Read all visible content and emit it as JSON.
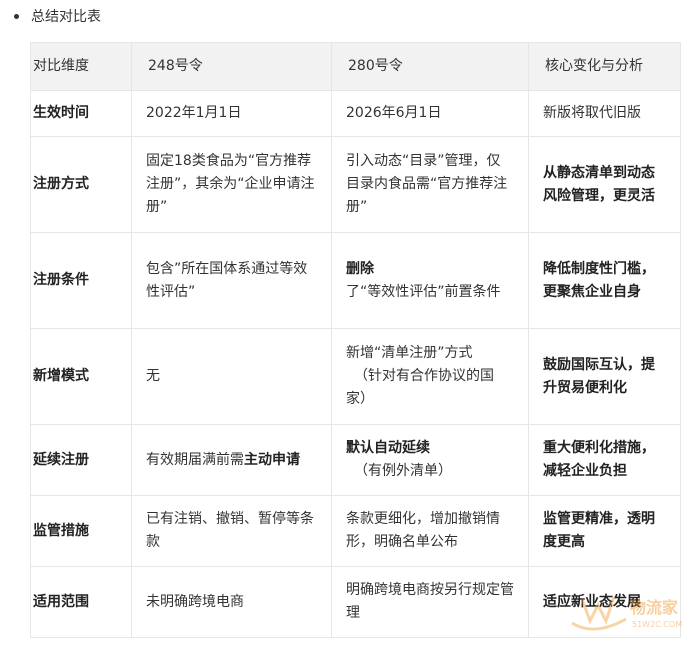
{
  "heading": "总结对比表",
  "table": {
    "headers": [
      "对比维度",
      "248号令",
      "280号令",
      "核心变化与分析"
    ],
    "rows": [
      {
        "dim": "生效时间",
        "c248": "2022年1月1日",
        "c280_a": "2026年6月1日",
        "c280_b": "",
        "analysis": "新版将取代旧版"
      },
      {
        "dim": "注册方式",
        "c248_a": "固定18类食品为“官方推荐注册”，其余为“企业申请注册”",
        "c280_a": "引入动态“目录”管理，仅目录内食品需“官方推荐注册”",
        "analysis": "从静态清单到动态风险管理，更灵活"
      },
      {
        "dim": "注册条件",
        "c248_a": "包含”所在国体系通过等效性评估”",
        "c280_bold": "删除",
        "c280_a": "了“等效性评估”前置条件",
        "analysis": "降低制度性门槛，更聚焦企业自身"
      },
      {
        "dim": "新增模式",
        "c248_a": "无",
        "c280_a": "新增“清单注册”方式",
        "c280_b": "（针对有合作协议的国家）",
        "analysis": "鼓励国际互认，提升贸易便利化"
      },
      {
        "dim": "延续注册",
        "c248_a": "有效期届满前需",
        "c248_bold": "主动申请",
        "c280_bold": "默认自动延续",
        "c280_b": "（有例外清单）",
        "analysis": "重大便利化措施，减轻企业负担"
      },
      {
        "dim": "监管措施",
        "c248_a": "已有注销、撤销、暂停等条款",
        "c280_a": "条款更细化，增加撤销情形，明确名单公布",
        "analysis": "监管更精准，透明度更高"
      },
      {
        "dim": "适用范围",
        "c248_a": "未明确跨境电商",
        "c280_a": "明确跨境电商按另行规定管理",
        "analysis": "适应新业态发展"
      }
    ]
  },
  "watermark": {
    "brand": "物流家",
    "url": "51W2C.COM",
    "color": "#f0a03c"
  }
}
